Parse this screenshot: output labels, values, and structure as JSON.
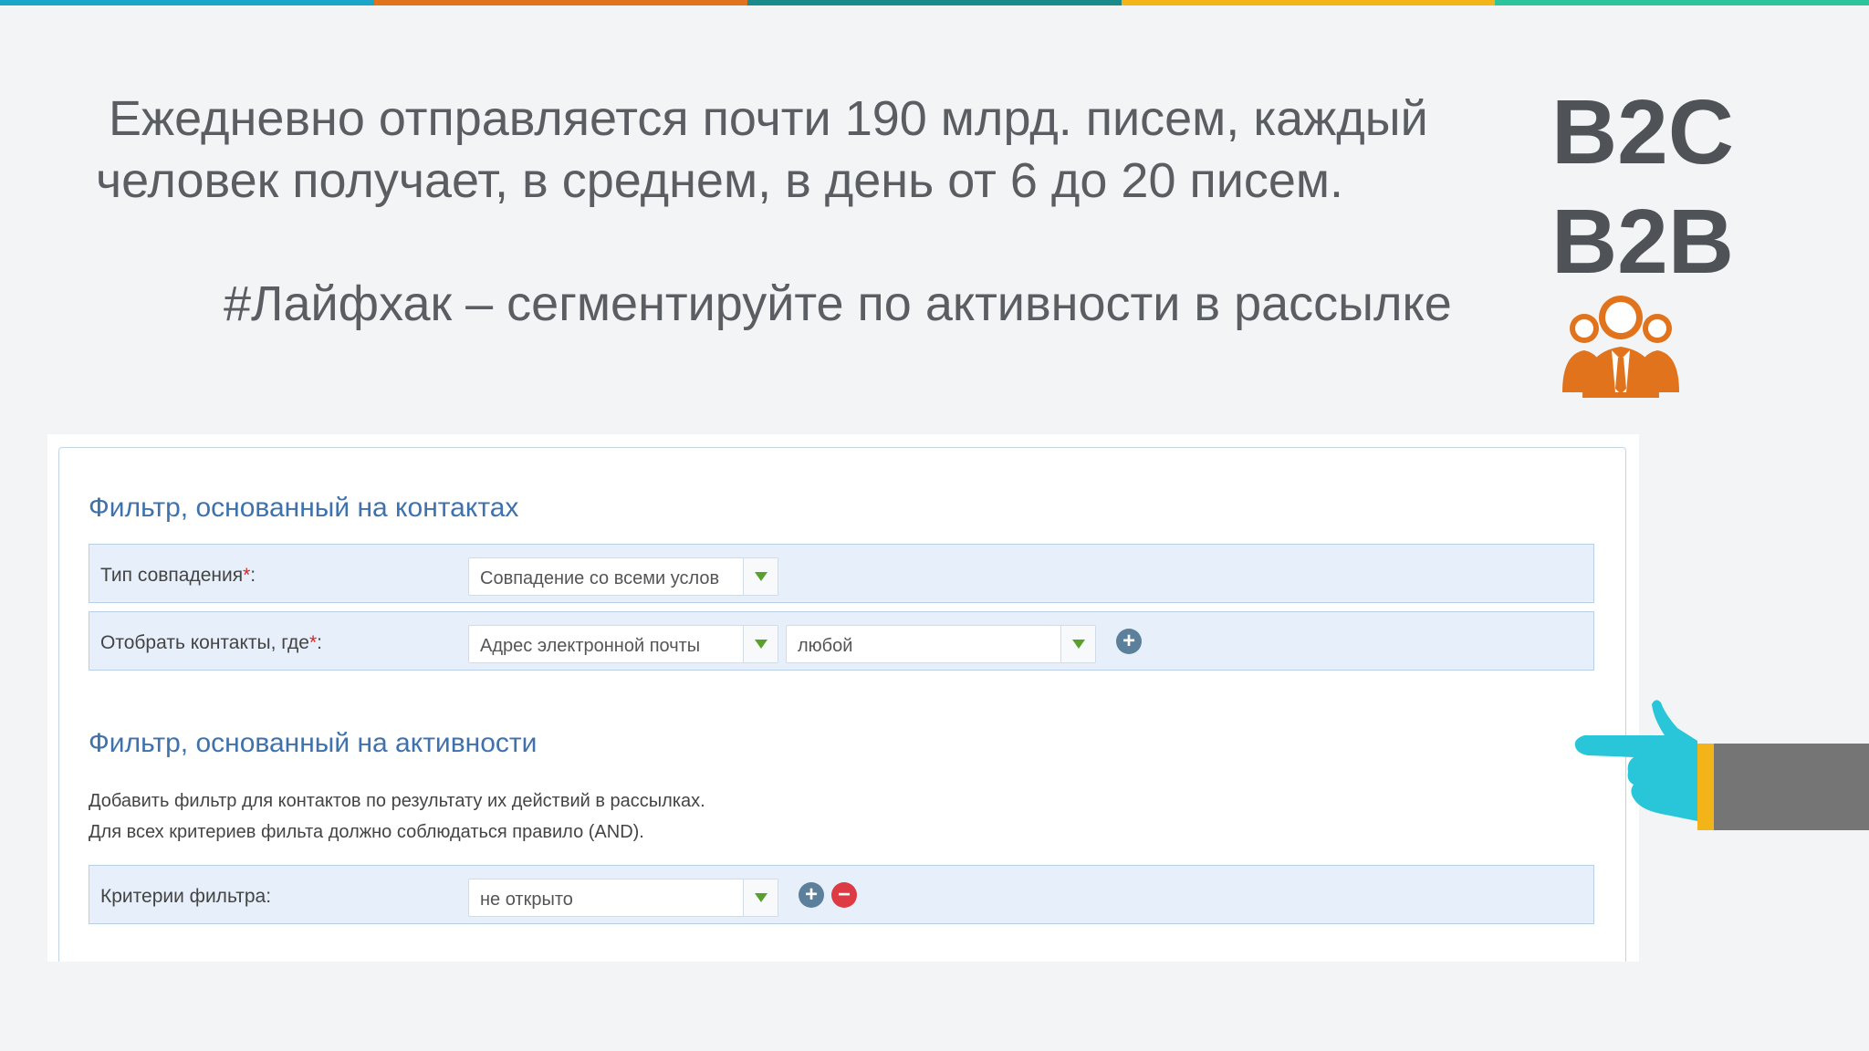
{
  "colors": {
    "stripe": [
      "#1aa6c9",
      "#e0731c",
      "#1b8a8a",
      "#f2b418",
      "#2cc49a"
    ],
    "accent_orange": "#e0731c",
    "filter_title_blue": "#3f72ad"
  },
  "slide": {
    "headline_line1": "Ежедневно отправляется почти 190 млрд. писем, каждый",
    "headline_line2": "человек получает, в среднем, в  день от 6 до 20 писем.",
    "tip": "#Лайфхак – сегментируйте по активности в рассылке",
    "b2c": "B2C",
    "b2b": "B2B",
    "people_icon": "group-of-people-icon",
    "hand_icon": "pointing-hand-icon"
  },
  "contact_filter": {
    "title": "Фильтр, основанный на контактах",
    "match_type": {
      "label": "Тип совпадения",
      "required_mark": "*",
      "label_suffix": ":",
      "value": "Совпадение со всеми услов"
    },
    "select_contacts": {
      "label": "Отобрать контакты, где",
      "required_mark": "*",
      "label_suffix": ":",
      "field_value": "Адрес электронной почты",
      "condition_value": "любой",
      "add_icon": "+"
    }
  },
  "activity_filter": {
    "title": "Фильтр, основанный на активности",
    "desc_line1": "Добавить фильтр для контактов по результату их действий в рассылках.",
    "desc_line2": "Для всех критериев фильта должно соблюдаться правило (AND).",
    "criteria": {
      "label": "Критерии фильтра:",
      "value": "не открыто",
      "add_icon": "+",
      "remove_icon": "−"
    }
  }
}
